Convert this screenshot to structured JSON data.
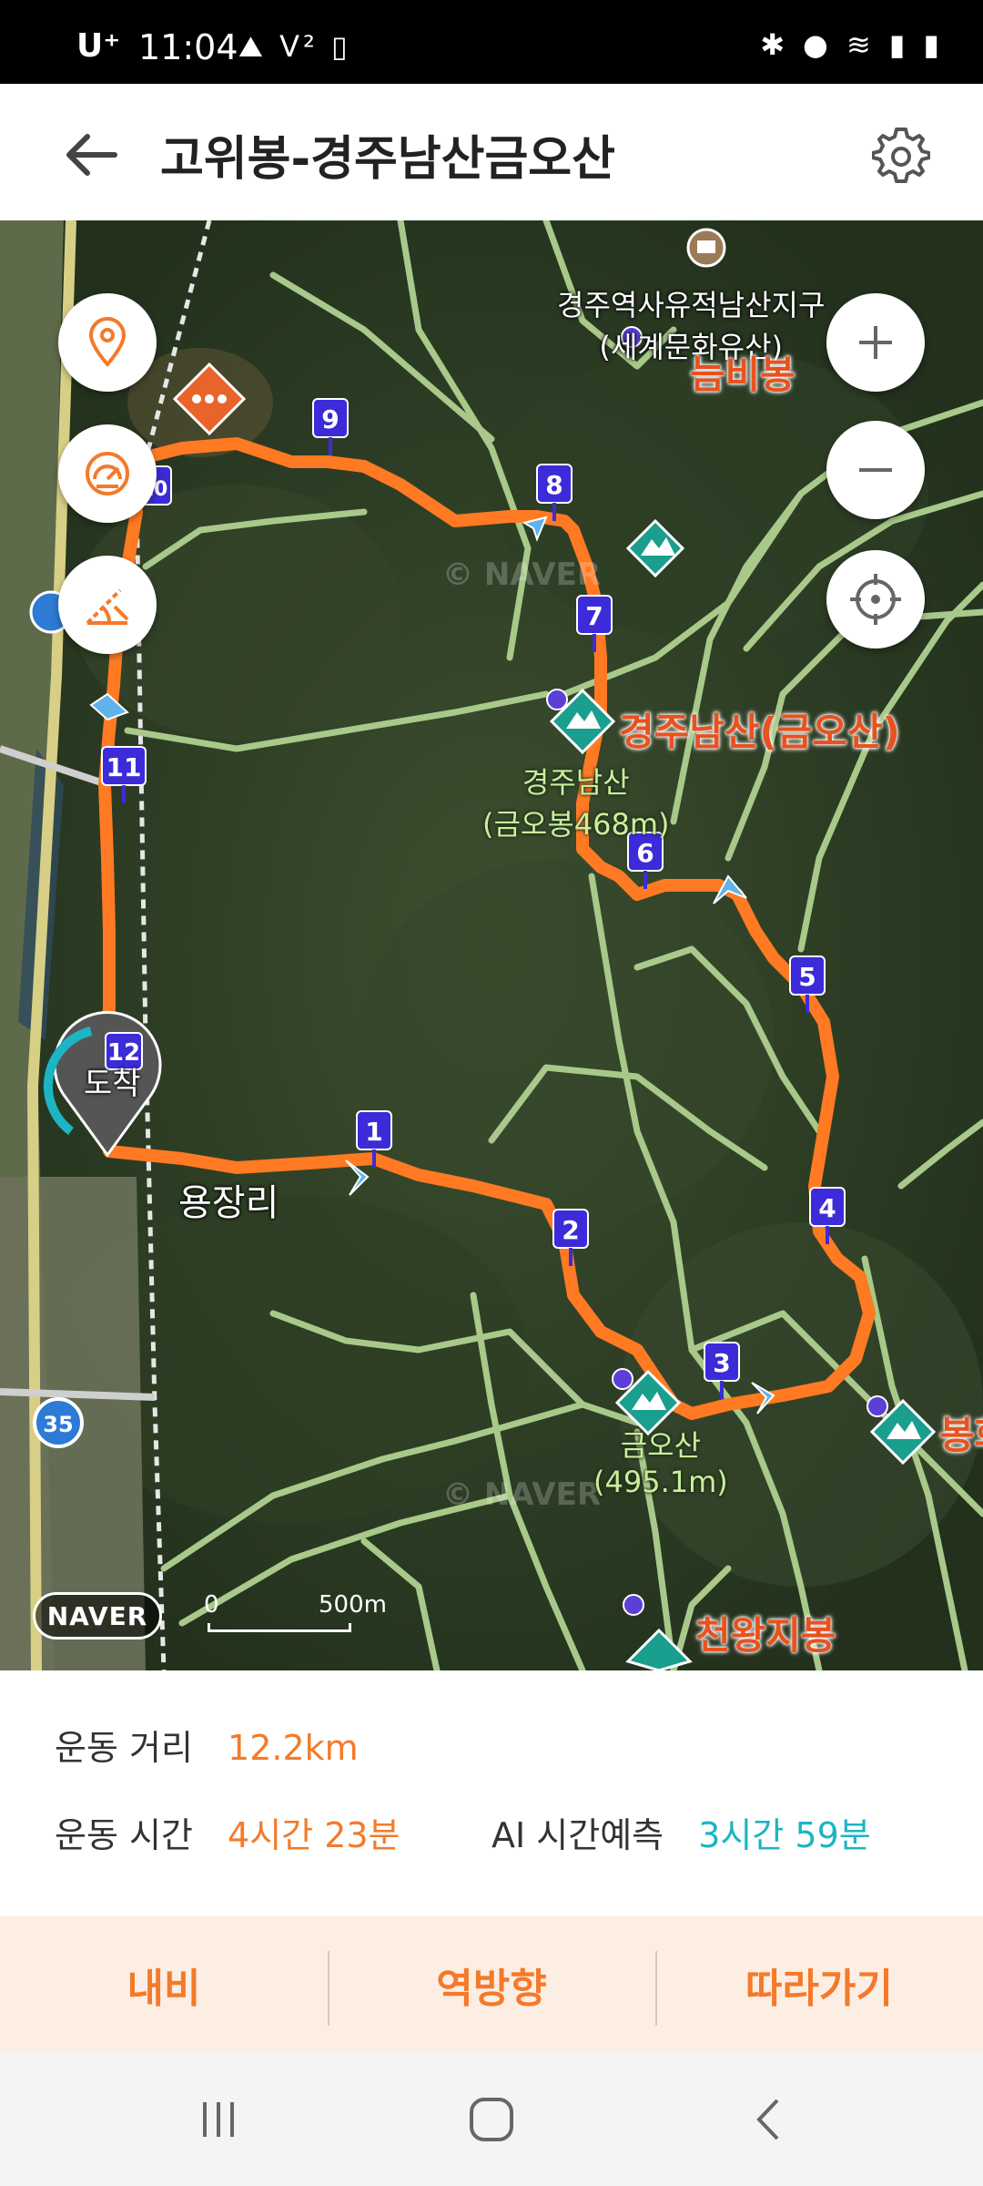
{
  "status_bar": {
    "carrier": "U⁺",
    "time": "11:04",
    "left_icons": [
      "hiking-icon",
      "vt-icon",
      "phone-icon"
    ],
    "right_icons": [
      "bluetooth-icon",
      "location-icon",
      "wifi-icon",
      "signal-icon",
      "battery-icon"
    ]
  },
  "header": {
    "title": "고위봉-경주남산금오산"
  },
  "map": {
    "peaks": {
      "neumbi": "늠비봉",
      "gyeongju_namsan": "경주남산(금오산)",
      "geumo": "금오산",
      "geumo_height": "(495.1m)",
      "cheonwang": "천왕지봉",
      "bong_partial": "봉화",
      "namsan_sub1": "경주남산",
      "namsan_sub2": "(금오봉468m)"
    },
    "poi": {
      "line1": "경주역사유적남산지구",
      "line2": "(세계문화유산)"
    },
    "place": "용장리",
    "start_marker": "도착",
    "waypoints": [
      "1",
      "2",
      "3",
      "4",
      "5",
      "6",
      "7",
      "8",
      "9",
      "10",
      "11",
      "12"
    ],
    "road_badges": [
      "35",
      "35"
    ],
    "naver_logo": "NAVER",
    "scale_zero": "0",
    "scale_value": "500m",
    "watermark": "© NAVER"
  },
  "stats": {
    "distance_label": "운동 거리",
    "distance_value": "12.2km",
    "time_label": "운동 시간",
    "time_value": "4시간 23분",
    "ai_label": "AI 시간예측",
    "ai_value": "3시간 59분"
  },
  "actions": {
    "navigate": "내비",
    "reverse": "역방향",
    "follow": "따라가기"
  },
  "colors": {
    "accent": "#f47a2a",
    "teal": "#1db4c4",
    "route": "#ff7a22",
    "waypoint": "#3c2bd8",
    "trail": "#a8c98a",
    "peak_marker": "#1a9e8e"
  }
}
